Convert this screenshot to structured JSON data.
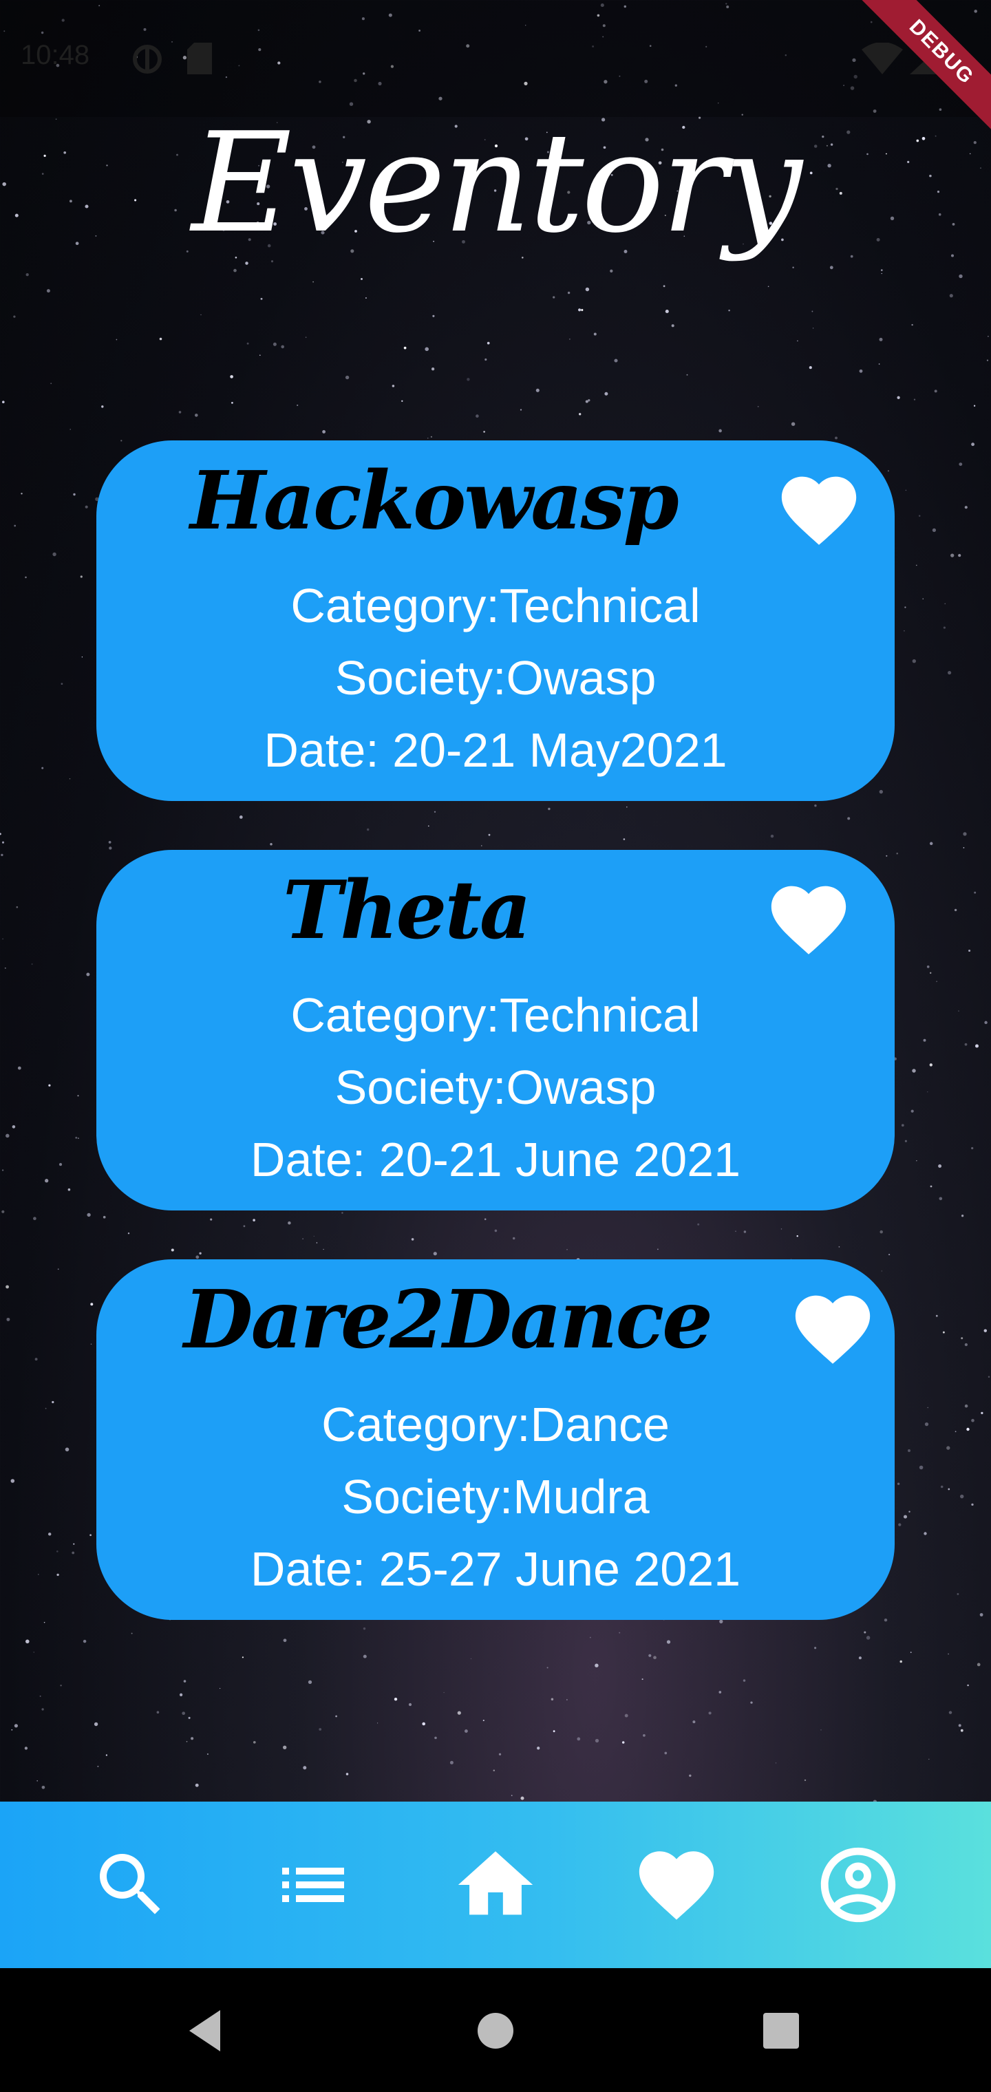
{
  "status_bar": {
    "time": "10:48",
    "debug_label": "DEBUG"
  },
  "app": {
    "title": "Eventory"
  },
  "events": [
    {
      "name": "Hackowasp",
      "category": "Category:Technical",
      "society": "Society:Owasp",
      "date": "Date: 20-21 May2021"
    },
    {
      "name": "Theta",
      "category": "Category:Technical",
      "society": "Society:Owasp",
      "date": "Date: 20-21 June 2021"
    },
    {
      "name": "Dare2Dance",
      "category": "Category:Dance",
      "society": "Society:Mudra",
      "date": "Date: 25-27 June 2021"
    }
  ],
  "bottom_nav": {
    "items": [
      {
        "icon": "search-icon"
      },
      {
        "icon": "list-icon"
      },
      {
        "icon": "home-icon"
      },
      {
        "icon": "heart-icon"
      },
      {
        "icon": "account-circle-icon"
      }
    ]
  },
  "colors": {
    "card": "#1d9ff7",
    "nav_gradient_start": "#1ba4f7",
    "nav_gradient_end": "#5ae0dd",
    "debug_ribbon": "#a01c32"
  }
}
